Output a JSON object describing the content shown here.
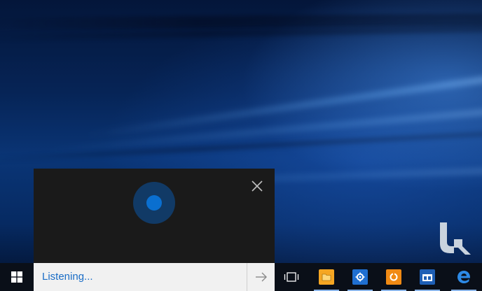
{
  "cortana": {
    "close_icon": "close-icon",
    "orb_colors": {
      "outer": "#113a66",
      "inner": "#0a6fd0"
    }
  },
  "search": {
    "text": "Listening...",
    "submit_icon": "arrow-right-icon"
  },
  "taskbar": {
    "start_icon": "windows-logo-icon",
    "task_view_icon": "task-view-icon",
    "apps": [
      {
        "icon": "file-explorer-icon",
        "color": "#f5a623"
      },
      {
        "icon": "settings-icon",
        "color": "#1f6fd1"
      },
      {
        "icon": "app-orange-icon",
        "color": "#f08a14"
      },
      {
        "icon": "store-app-icon",
        "color": "#1e5fb5"
      },
      {
        "icon": "edge-browser-icon",
        "color": "#2d8ae6"
      }
    ]
  },
  "desktop": {
    "watermark_icon": "watermark-logo-icon"
  }
}
